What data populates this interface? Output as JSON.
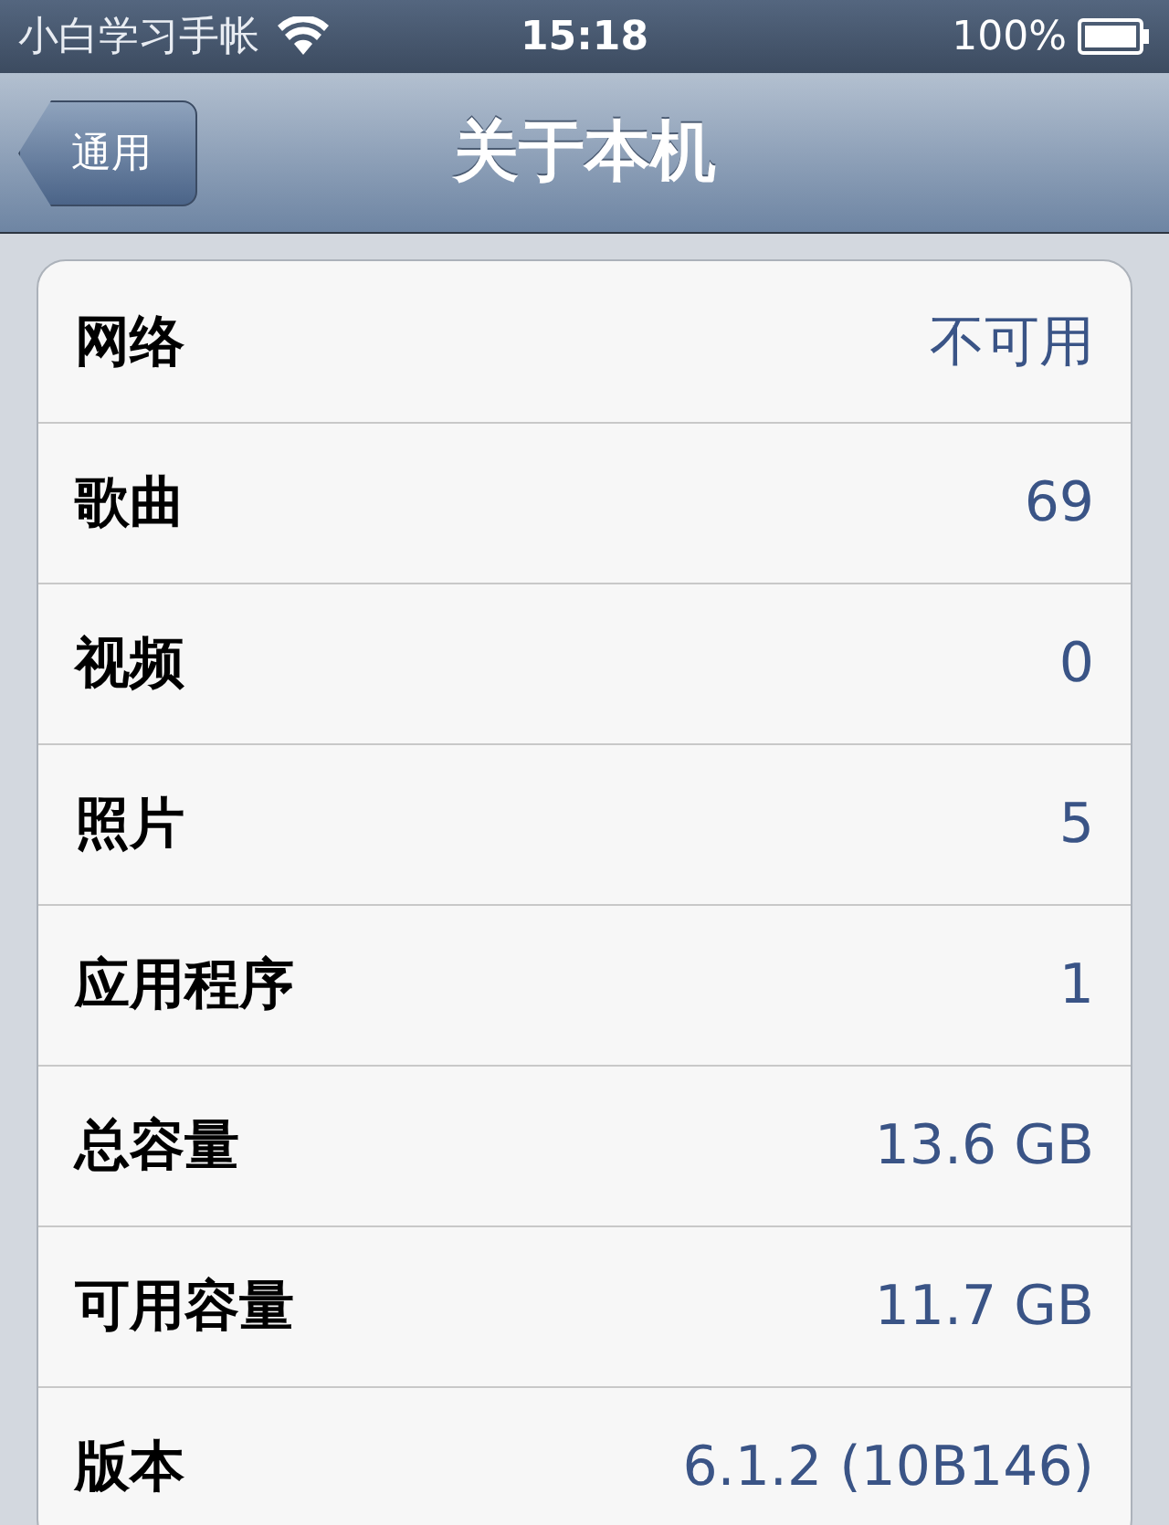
{
  "status_bar": {
    "carrier": "小白学习手帐",
    "time": "15:18",
    "battery": "100%"
  },
  "nav_bar": {
    "back_button": "通用",
    "title": "关于本机"
  },
  "rows": [
    {
      "label": "网络",
      "value": "不可用"
    },
    {
      "label": "歌曲",
      "value": "69"
    },
    {
      "label": "视频",
      "value": "0"
    },
    {
      "label": "照片",
      "value": "5"
    },
    {
      "label": "应用程序",
      "value": "1"
    },
    {
      "label": "总容量",
      "value": "13.6 GB"
    },
    {
      "label": "可用容量",
      "value": "11.7 GB"
    },
    {
      "label": "版本",
      "value": "6.1.2 (10B146)"
    }
  ]
}
